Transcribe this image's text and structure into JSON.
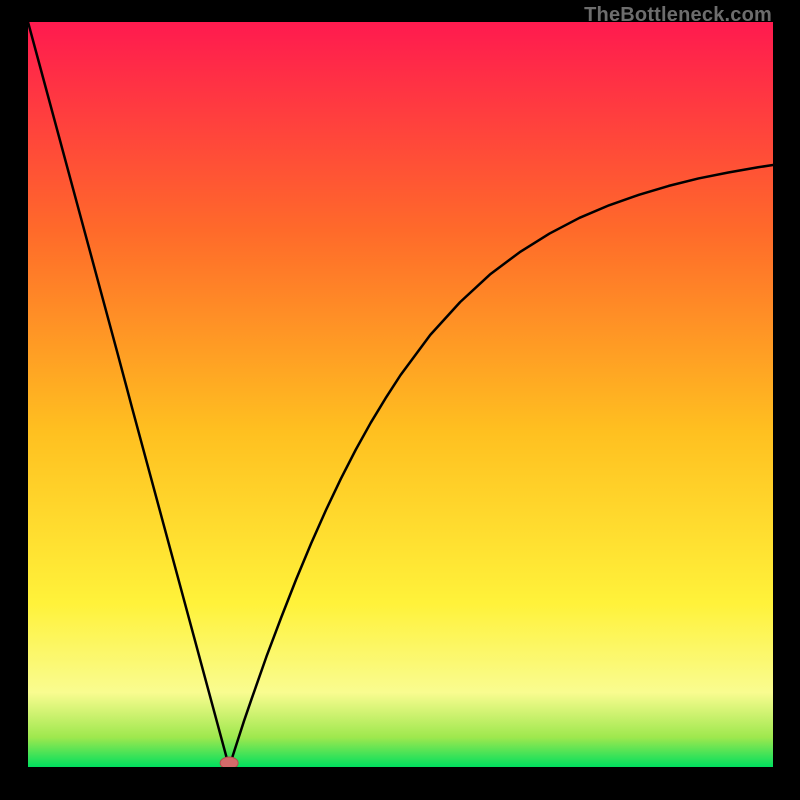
{
  "watermark": "TheBottleneck.com",
  "chart_data": {
    "type": "line",
    "title": "",
    "xlabel": "",
    "ylabel": "",
    "xlim": [
      0,
      100
    ],
    "ylim": [
      0,
      100
    ],
    "grid": false,
    "series": [
      {
        "name": "curve",
        "x": [
          0,
          2,
          4,
          6,
          8,
          10,
          12,
          14,
          16,
          18,
          20,
          22,
          24,
          26,
          27,
          28,
          29,
          30,
          32,
          34,
          36,
          38,
          40,
          42,
          44,
          46,
          48,
          50,
          54,
          58,
          62,
          66,
          70,
          74,
          78,
          82,
          86,
          90,
          94,
          98,
          100
        ],
        "y": [
          100,
          92.6,
          85.2,
          77.8,
          70.4,
          63.0,
          55.6,
          48.1,
          40.7,
          33.3,
          25.9,
          18.5,
          11.1,
          3.7,
          0.0,
          3.1,
          6.2,
          9.1,
          14.8,
          20.1,
          25.2,
          30.0,
          34.5,
          38.7,
          42.6,
          46.2,
          49.5,
          52.6,
          58.0,
          62.4,
          66.1,
          69.1,
          71.6,
          73.7,
          75.4,
          76.8,
          78.0,
          79.0,
          79.8,
          80.5,
          80.8
        ]
      }
    ],
    "highlight_point": {
      "x": 27,
      "y": 0,
      "color": "#d36a6a"
    },
    "background_gradient": {
      "top": "#ff1a4f",
      "upper_mid": "#ff8a2a",
      "mid": "#ffd020",
      "lower_mid": "#f9f970",
      "near_bottom": "#c9f45a",
      "bottom": "#00e060"
    }
  }
}
